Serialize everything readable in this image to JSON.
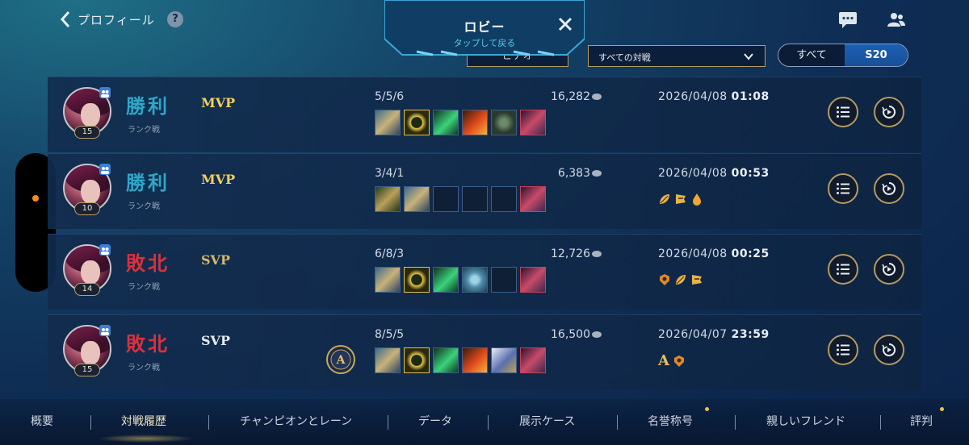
{
  "header": {
    "back_label": "プロフィール",
    "help_icon": "?",
    "chat_icon": "chat-icon",
    "friends_icon": "friends-icon"
  },
  "lobby": {
    "title": "ロビー",
    "subtitle": "タップして戻る"
  },
  "filters": {
    "video_label": "ビデオ",
    "dropdown_value": "すべての対戦",
    "toggle": [
      "すべて",
      "S20"
    ],
    "toggle_selected": "S20"
  },
  "matches": [
    {
      "result": "勝利",
      "outcome": "win",
      "mode": "ランク戦",
      "badge": "MVP",
      "level": "15",
      "kda": "5/5/6",
      "gold": "16,282",
      "date": "2026/04/08",
      "time": "01:08",
      "items": [
        "arrow-item",
        "mythic-item",
        "green-blade-item",
        "fire-item",
        "armor-item",
        "trinket-item"
      ],
      "medals": [],
      "emblem": false
    },
    {
      "result": "勝利",
      "outcome": "win",
      "mode": "ランク戦",
      "badge": "MVP",
      "level": "10",
      "kda": "3/4/1",
      "gold": "6,383",
      "date": "2026/04/08",
      "time": "00:53",
      "items": [
        "bow-item",
        "arrow-item",
        "empty",
        "empty",
        "empty",
        "trinket-item"
      ],
      "medals": [
        "leaf-medal",
        "flag-medal",
        "drop-medal"
      ],
      "emblem": false
    },
    {
      "result": "敗北",
      "outcome": "loss",
      "mode": "ランク戦",
      "badge": "SVP",
      "level": "14",
      "kda": "6/8/3",
      "gold": "12,726",
      "date": "2026/04/08",
      "time": "00:25",
      "items": [
        "arrow-item",
        "mythic-item",
        "green-blade-item",
        "scale-item",
        "empty",
        "trinket-item"
      ],
      "medals": [
        "crest-medal",
        "leaf-medal",
        "flag-medal"
      ],
      "emblem": false
    },
    {
      "result": "敗北",
      "outcome": "loss",
      "mode": "ランク戦",
      "badge": "SVP",
      "level": "15",
      "kda": "8/5/5",
      "gold": "16,500",
      "date": "2026/04/07",
      "time": "23:59",
      "items": [
        "arrow-item",
        "mythic-item",
        "green-blade-item",
        "fire-item",
        "cloak-item",
        "trinket-item"
      ],
      "medals": [
        "A",
        "crest-medal"
      ],
      "emblem": true,
      "emblem_label": "A"
    }
  ],
  "bottom_tabs": [
    "概要",
    "対戦履歴",
    "チャンピオンとレーン",
    "データ",
    "展示ケース",
    "名誉称号",
    "親しいフレンド",
    "評判"
  ],
  "active_tab": "対戦履歴",
  "colors": {
    "win": "#2ea6c8",
    "loss": "#d7323e",
    "mvp": "#f4cf5c",
    "accent_gold": "#b79e64",
    "selected_blue": "#1b5fb5"
  }
}
